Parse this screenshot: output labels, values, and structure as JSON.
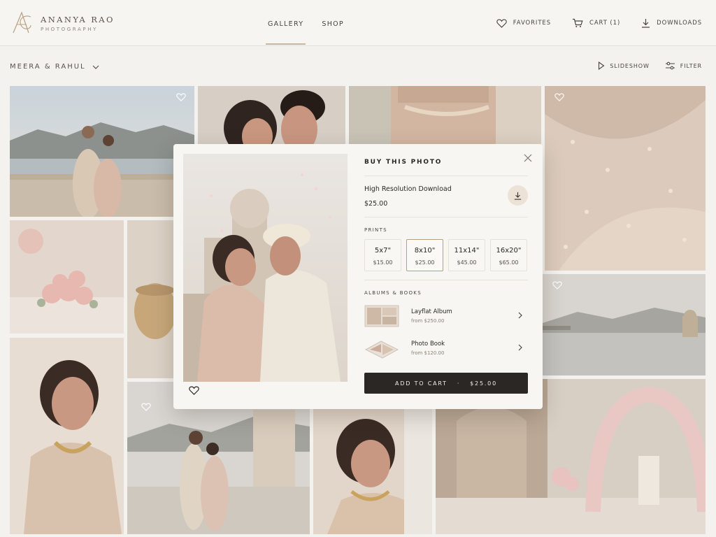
{
  "brand": {
    "name": "ANANYA RAO",
    "tagline": "PHOTOGRAPHY"
  },
  "nav": {
    "items": [
      {
        "label": "GALLERY",
        "active": true
      },
      {
        "label": "SHOP",
        "active": false
      }
    ]
  },
  "header_actions": {
    "favorites": "FAVORITES",
    "cart": "CART (1)",
    "downloads": "DOWNLOADS"
  },
  "gallery": {
    "title": "MEERA & RAHUL"
  },
  "view_tools": {
    "slideshow": "SLIDESHOW",
    "filter": "FILTER"
  },
  "purchase": {
    "title": "BUY THIS PHOTO",
    "download": {
      "label": "High Resolution Download",
      "price": "$25.00"
    },
    "prints_label": "PRINTS",
    "prints": [
      {
        "size": "5x7\"",
        "price": "$15.00",
        "selected": false
      },
      {
        "size": "8x10\"",
        "price": "$25.00",
        "selected": true
      },
      {
        "size": "11x14\"",
        "price": "$45.00",
        "selected": false
      },
      {
        "size": "16x20\"",
        "price": "$65.00",
        "selected": false
      }
    ],
    "albums_label": "ALBUMS & BOOKS",
    "albums": [
      {
        "name": "Layflat Album",
        "price": "from $250.00"
      },
      {
        "name": "Photo Book",
        "price": "from $120.00"
      }
    ],
    "add_to_cart": {
      "label": "ADD TO CART",
      "separator": "·",
      "price": "$25.00"
    }
  },
  "colors": {
    "accent": "#c9b59a",
    "button_dark": "#2a2725",
    "background": "#f4f2ef"
  },
  "icons": [
    "heart-icon",
    "cart-icon",
    "download-icon",
    "chevron-down-icon",
    "play-icon",
    "filter-icon",
    "close-icon",
    "chevron-right-icon"
  ]
}
